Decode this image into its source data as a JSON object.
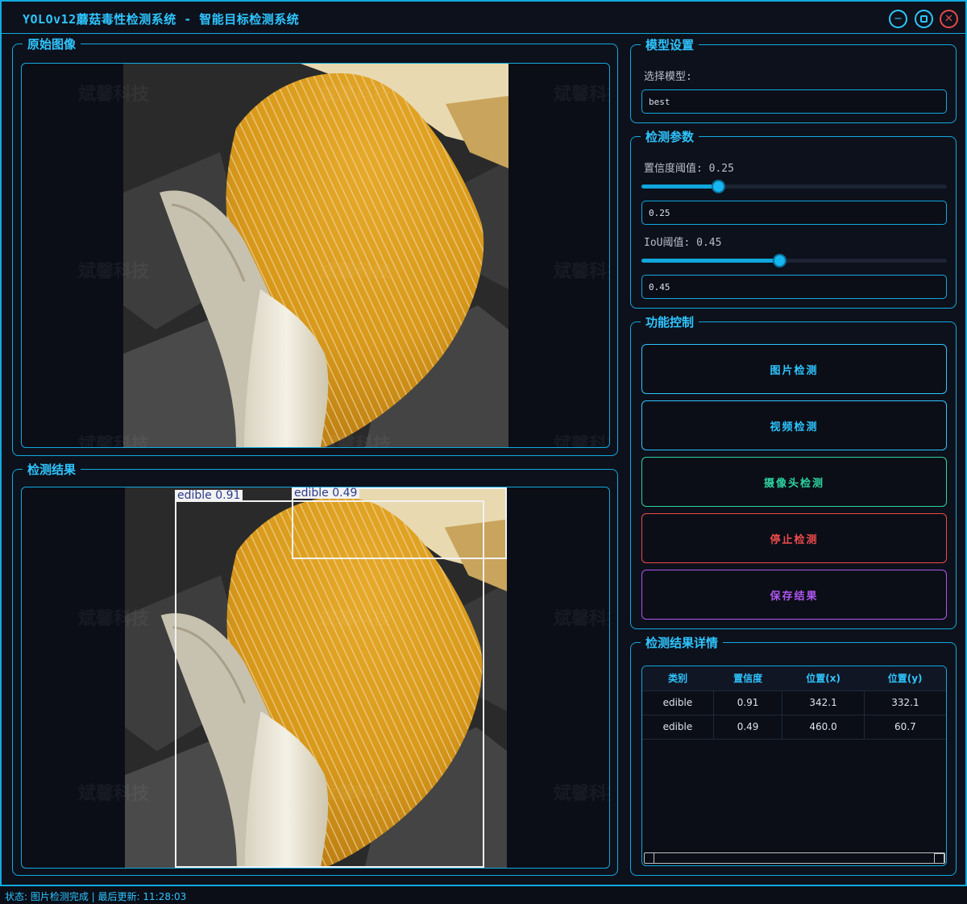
{
  "window": {
    "title": "YOLOv12蘑菇毒性检测系统 - 智能目标检测系统",
    "controls": {
      "minimize": "−",
      "close": "✕"
    }
  },
  "panels": {
    "original": {
      "title": "原始图像"
    },
    "result": {
      "title": "检测结果"
    },
    "model": {
      "title": "模型设置",
      "label": "选择模型:",
      "value": "best"
    },
    "params": {
      "title": "检测参数",
      "conf_label": "置信度阈值: 0.25",
      "conf_value": "0.25",
      "conf_level": 0.25,
      "iou_label": "IoU阈值: 0.45",
      "iou_value": "0.45",
      "iou_level": 0.45
    },
    "controls": {
      "title": "功能控制",
      "buttons": [
        {
          "label": "图片检测",
          "color": "#2ec5ff"
        },
        {
          "label": "视频检测",
          "color": "#2ec5ff"
        },
        {
          "label": "摄像头检测",
          "color": "#2ed3a0"
        },
        {
          "label": "停止检测",
          "color": "#ee4b4b"
        },
        {
          "label": "保存结果",
          "color": "#b056f0"
        }
      ]
    },
    "details": {
      "title": "检测结果详情",
      "columns": [
        "类别",
        "置信度",
        "位置(x)",
        "位置(y)"
      ],
      "rows": [
        [
          "edible",
          "0.91",
          "342.1",
          "332.1"
        ],
        [
          "edible",
          "0.49",
          "460.0",
          "60.7"
        ]
      ]
    }
  },
  "detections": [
    {
      "label": "edible 0.91"
    },
    {
      "label": "edible 0.49"
    }
  ],
  "watermark": "斌馨科技",
  "status": "状态: 图片检测完成 | 最后更新: 11:28:03",
  "colors": {
    "accent": "#12a9e0",
    "title": "#2ec5ff",
    "background": "#0d111b"
  }
}
